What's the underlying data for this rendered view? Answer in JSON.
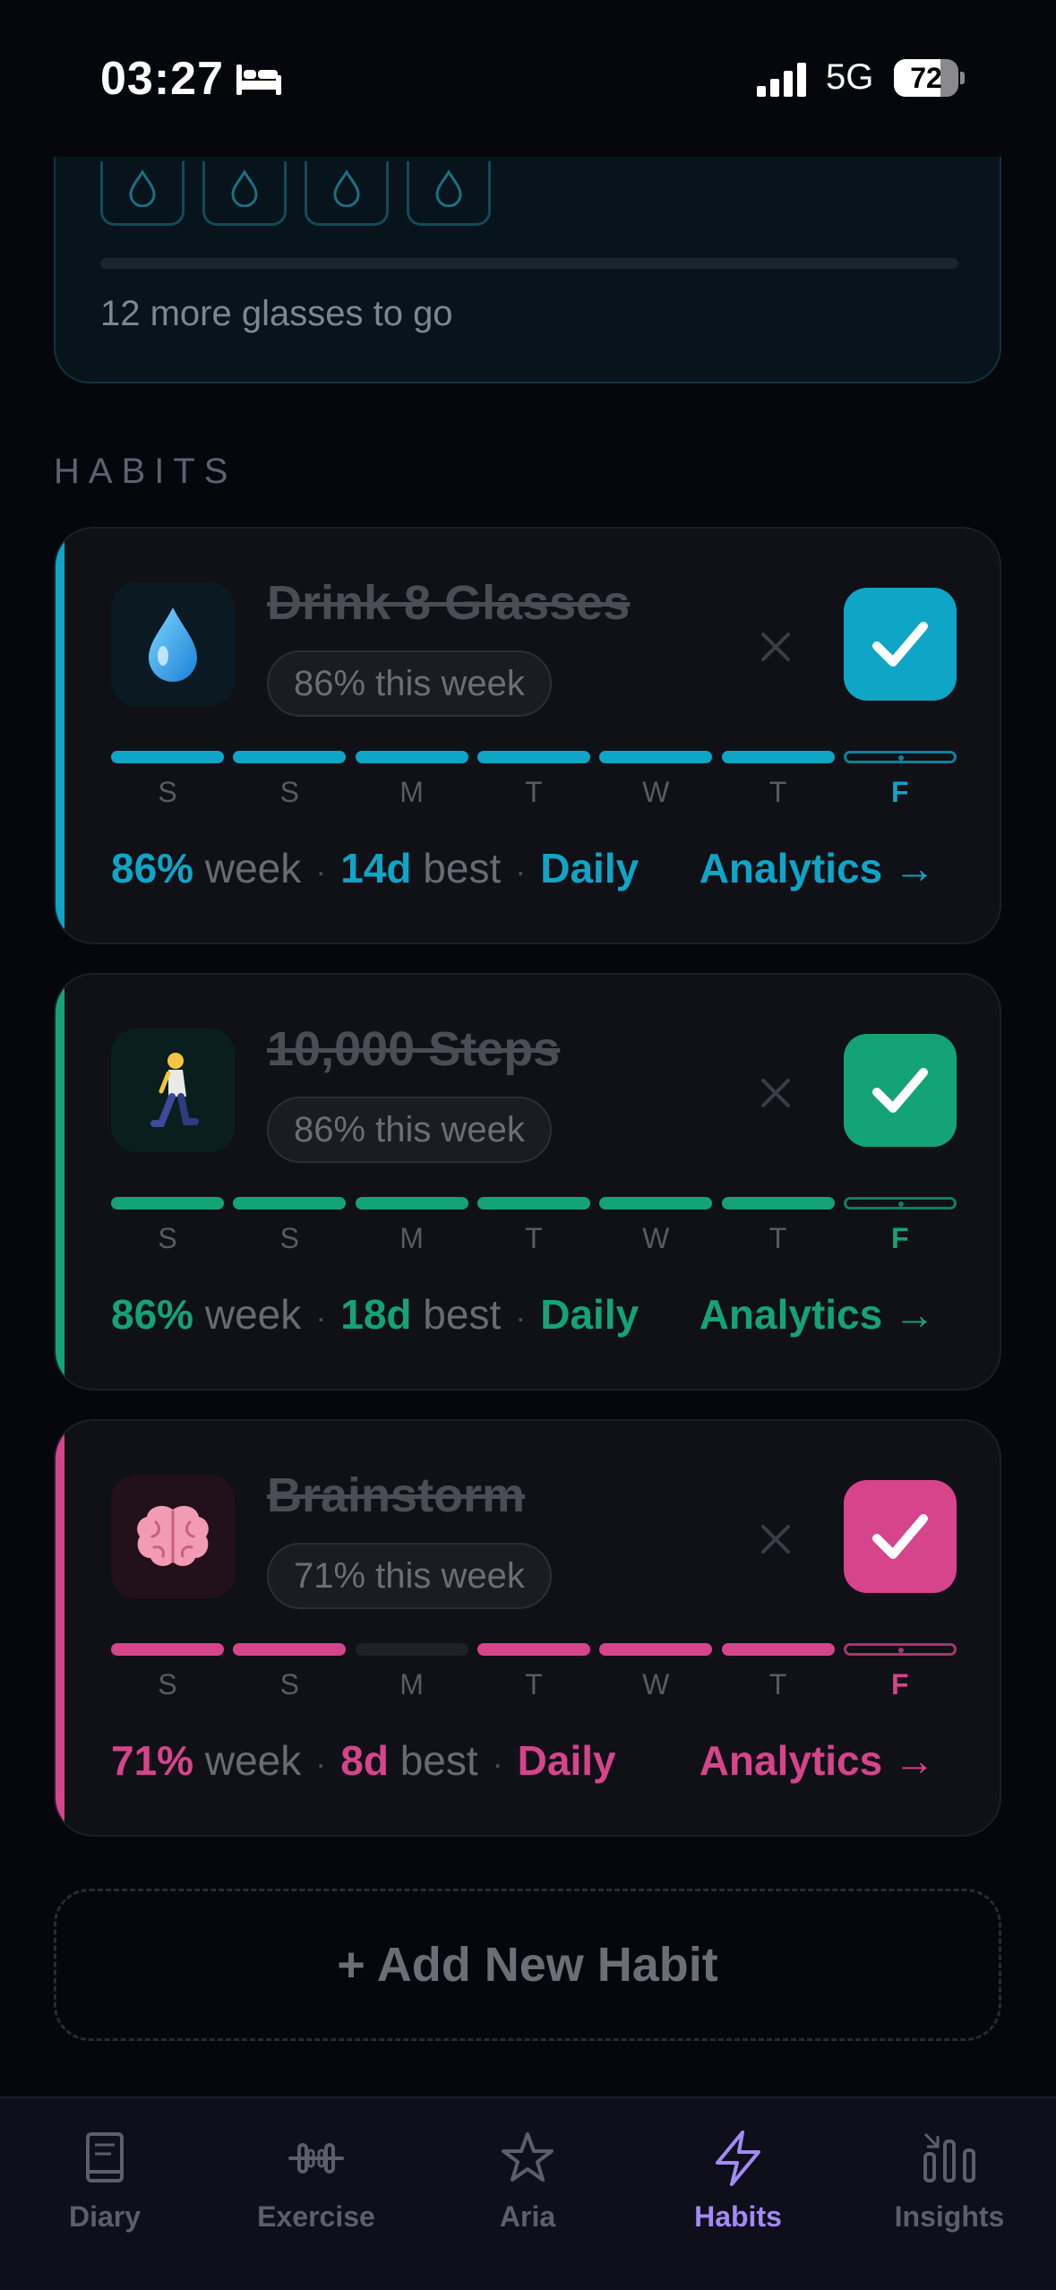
{
  "status_bar": {
    "time": "03:27",
    "network": "5G",
    "battery": "72",
    "battery_level": 0.72
  },
  "water_card": {
    "remaining_text": "12 more glasses to go",
    "visible_glasses": 4
  },
  "section": {
    "title": "HABITS"
  },
  "colors": {
    "cyan": "#0ea5c7",
    "green": "#14a374",
    "pink": "#d6448b",
    "tab_active": "#a48af5"
  },
  "habits": [
    {
      "title": "Drink 8 Glasses",
      "icon": "water-drop-icon",
      "pill": "86% this week",
      "days": [
        "S",
        "S",
        "M",
        "T",
        "W",
        "T",
        "F"
      ],
      "completed": [
        true,
        true,
        true,
        true,
        true,
        true,
        false
      ],
      "today_index": 6,
      "week_pct": "86%",
      "week_label": "week",
      "best_value": "14d",
      "best_label": "best",
      "frequency": "Daily",
      "analytics": "Analytics →"
    },
    {
      "title": "10,000 Steps",
      "icon": "walking-person-icon",
      "pill": "86% this week",
      "days": [
        "S",
        "S",
        "M",
        "T",
        "W",
        "T",
        "F"
      ],
      "completed": [
        true,
        true,
        true,
        true,
        true,
        true,
        false
      ],
      "today_index": 6,
      "week_pct": "86%",
      "week_label": "week",
      "best_value": "18d",
      "best_label": "best",
      "frequency": "Daily",
      "analytics": "Analytics →"
    },
    {
      "title": "Brainstorm",
      "icon": "brain-icon",
      "pill": "71% this week",
      "days": [
        "S",
        "S",
        "M",
        "T",
        "W",
        "T",
        "F"
      ],
      "completed": [
        true,
        true,
        false,
        true,
        true,
        true,
        false
      ],
      "today_index": 6,
      "week_pct": "71%",
      "week_label": "week",
      "best_value": "8d",
      "best_label": "best",
      "frequency": "Daily",
      "analytics": "Analytics →"
    }
  ],
  "add_habit": {
    "label": "+ Add New Habit"
  },
  "tabs": [
    {
      "label": "Diary",
      "icon": "book-icon",
      "active": false
    },
    {
      "label": "Exercise",
      "icon": "dumbbell-icon",
      "active": false
    },
    {
      "label": "Aria",
      "icon": "star-icon",
      "active": false
    },
    {
      "label": "Habits",
      "icon": "lightning-icon",
      "active": true
    },
    {
      "label": "Insights",
      "icon": "bar-chart-icon",
      "active": false
    }
  ]
}
